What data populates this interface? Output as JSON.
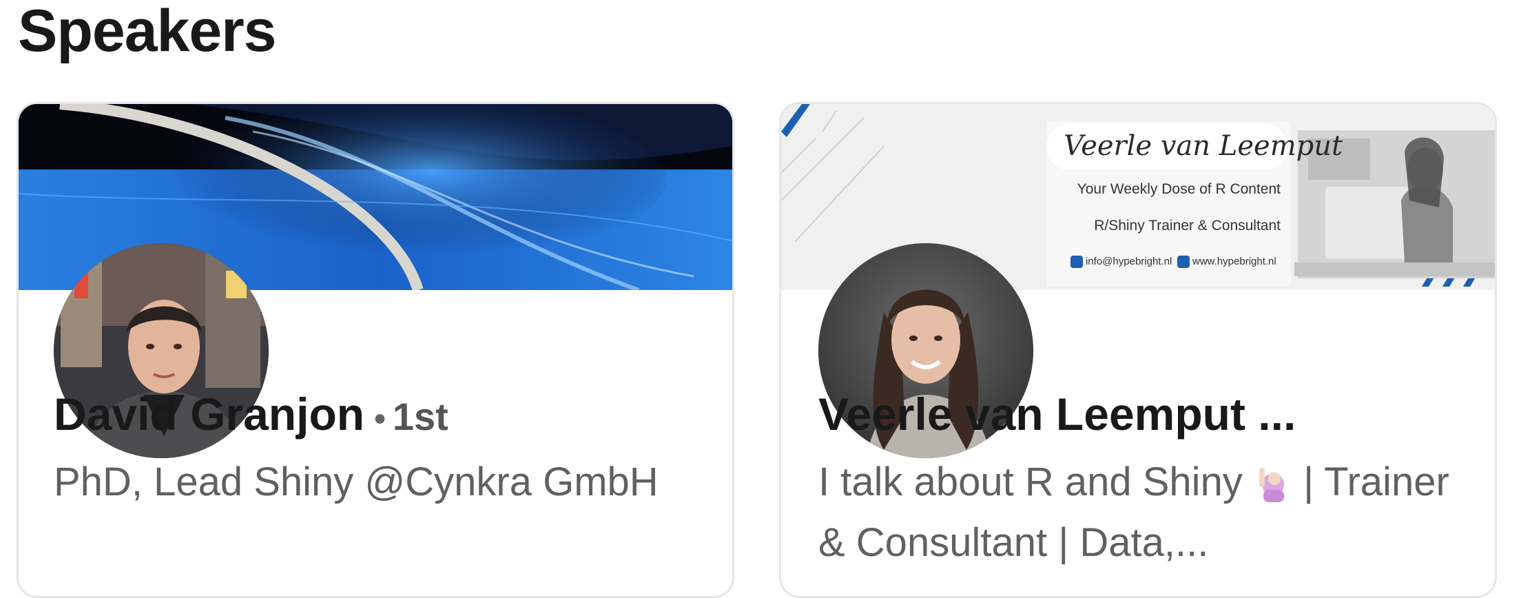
{
  "section": {
    "title": "Speakers"
  },
  "speakers": [
    {
      "name": "David Granjon",
      "degree": "1st",
      "headline": "PhD, Lead Shiny @Cynkra GmbH"
    },
    {
      "name": "Veerle van Leemput ...",
      "headline_part1": "I talk about R and Shiny",
      "headline_part2": "| Trainer & Consultant | Data,...",
      "emoji": "woman-raising-hand",
      "banner": {
        "signature": "Veerle van Leemput",
        "tagline": "Your Weekly Dose of R Content",
        "role": "R/Shiny Trainer & Consultant",
        "email": "info@hypebright.nl",
        "website": "www.hypebright.nl"
      }
    }
  ],
  "colors": {
    "banner1_blue": "#1f6fd6",
    "banner1_dark": "#05070f",
    "banner2_bg": "#f2f2f2"
  }
}
